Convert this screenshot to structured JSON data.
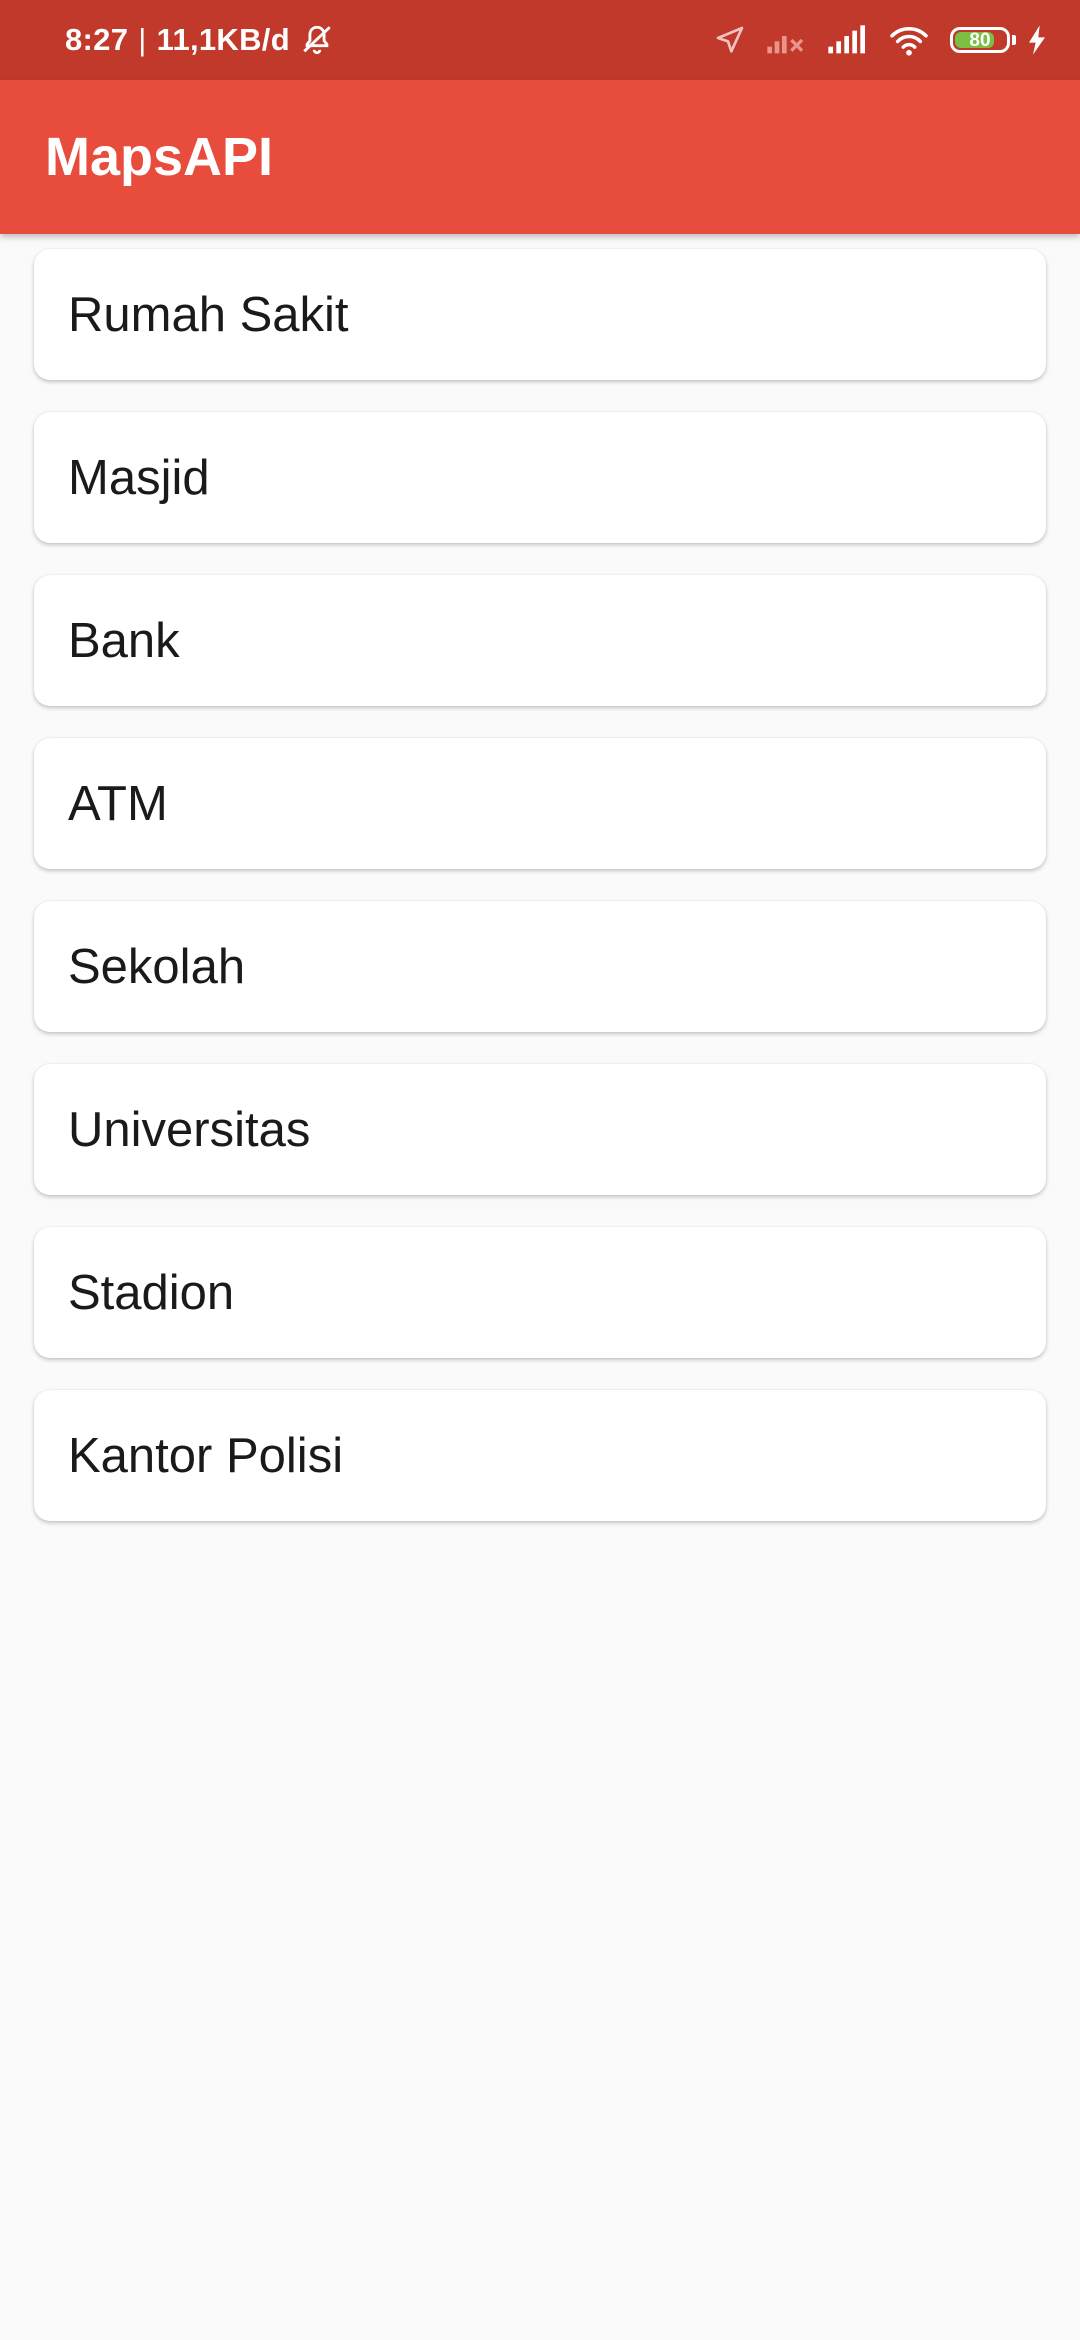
{
  "status_bar": {
    "time": "8:27",
    "separator": "|",
    "network_speed": "11,1KB/d",
    "icons": [
      "bell-off-icon",
      "location-arrow-icon",
      "signal-no-service-icon",
      "signal-icon",
      "wifi-icon",
      "battery-icon",
      "charging-icon"
    ],
    "battery_level": "80",
    "battery_fraction": 0.8,
    "background_color": "#c0392b"
  },
  "app_bar": {
    "title": "MapsAPI",
    "background_color": "#e74c3c"
  },
  "places": [
    {
      "label": "Rumah Sakit"
    },
    {
      "label": "Masjid"
    },
    {
      "label": "Bank"
    },
    {
      "label": "ATM"
    },
    {
      "label": "Sekolah"
    },
    {
      "label": "Universitas"
    },
    {
      "label": "Stadion"
    },
    {
      "label": "Kantor Polisi"
    }
  ]
}
